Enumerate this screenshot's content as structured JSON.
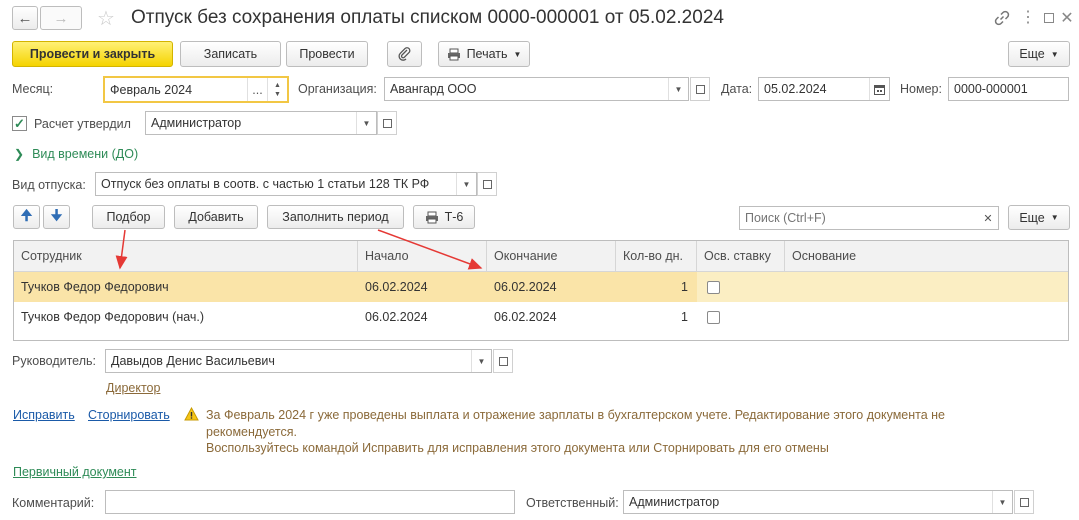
{
  "window": {
    "title": "Отпуск без сохранения оплаты списком 0000-000001 от 05.02.2024"
  },
  "toolbar": {
    "post_and_close": "Провести и закрыть",
    "save": "Записать",
    "post": "Провести",
    "print": "Печать",
    "more": "Еще"
  },
  "header": {
    "month_label": "Месяц:",
    "month_value": "Февраль 2024",
    "month_dots": "...",
    "org_label": "Организация:",
    "org_value": "Авангард ООО",
    "date_label": "Дата:",
    "date_value": "05.02.2024",
    "number_label": "Номер:",
    "number_value": "0000-000001",
    "approved_label": "Расчет утвердил",
    "approved_checked": true,
    "approver_value": "Администратор",
    "time_type_label": "Вид времени (ДО)",
    "leave_type_label": "Вид отпуска:",
    "leave_type_value": "Отпуск без оплаты в соотв. с частью 1 статьи 128 ТК РФ"
  },
  "table_toolbar": {
    "pick": "Подбор",
    "add": "Добавить",
    "fill_period": "Заполнить период",
    "t6": "Т-6",
    "search_placeholder": "Поиск (Ctrl+F)",
    "more": "Еще"
  },
  "table": {
    "columns": [
      "Сотрудник",
      "Начало",
      "Окончание",
      "Кол-во дн.",
      "Осв. ставку",
      "Основание"
    ],
    "rows": [
      {
        "employee": "Тучков Федор Федорович",
        "start": "06.02.2024",
        "end": "06.02.2024",
        "days": "1",
        "free_rate": false,
        "basis": ""
      },
      {
        "employee": "Тучков Федор Федорович (нач.)",
        "start": "06.02.2024",
        "end": "06.02.2024",
        "days": "1",
        "free_rate": false,
        "basis": ""
      }
    ]
  },
  "footer": {
    "manager_label": "Руководитель:",
    "manager_value": "Давыдов Денис Васильевич",
    "manager_position": "Директор",
    "fix_link": "Исправить",
    "reverse_link": "Сторнировать",
    "warning_line1": "За Февраль 2024 г уже проведены выплата и отражение зарплаты в бухгалтерском учете. Редактирование этого документа не",
    "warning_line2": "рекомендуется.",
    "warning_line3": "Воспользуйтесь командой Исправить для исправления этого документа или Сторнировать для его отмены",
    "primary_doc_link": "Первичный документ",
    "comment_label": "Комментарий:",
    "comment_value": "",
    "responsible_label": "Ответственный:",
    "responsible_value": "Администратор"
  },
  "colors": {
    "primary_button": "#f5d300",
    "selected_row": "#fbeec3",
    "link_green": "#2e8b57",
    "link_blue": "#1a5aa8",
    "annotation_arrow": "#e53935"
  },
  "icons": {
    "back": "arrow-left-icon",
    "forward": "arrow-right-icon",
    "favorite": "star-icon",
    "link": "chain-link-icon",
    "menu": "kebab-icon",
    "maximize": "square-icon",
    "close": "close-icon",
    "attach": "paperclip-icon",
    "print": "printer-icon",
    "calendar": "calendar-icon",
    "move_up": "arrow-up-icon",
    "move_down": "arrow-down-icon",
    "warning": "warning-icon"
  }
}
